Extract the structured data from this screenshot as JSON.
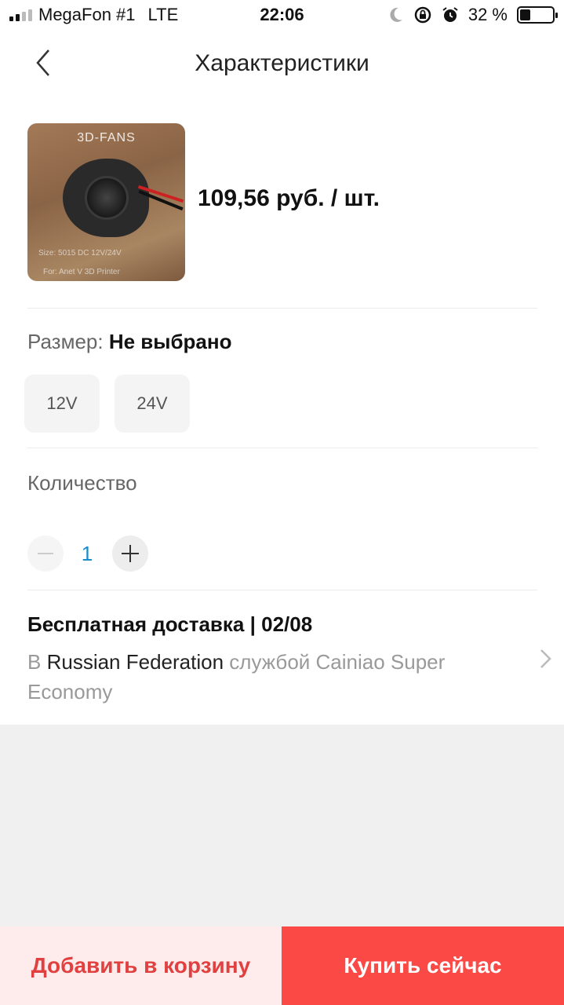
{
  "status_bar": {
    "carrier": "MegaFon #1",
    "network": "LTE",
    "time": "22:06",
    "battery_text": "32 %",
    "battery_level": 0.32,
    "icons": [
      "signal-icon",
      "moon-icon",
      "rotation-lock-icon",
      "alarm-icon",
      "battery-icon"
    ]
  },
  "nav": {
    "title": "Характеристики",
    "back_icon": "chevron-left-icon"
  },
  "product": {
    "image_text": {
      "brand": "3D-FANS",
      "spec": "Size: 5015 DC 12V/24V",
      "usage": "For: Anet V 3D Printer"
    },
    "price": "109,56 руб. / шт."
  },
  "size": {
    "label": "Размер:",
    "selected": "Не выбрано",
    "options": [
      "12V",
      "24V"
    ]
  },
  "quantity": {
    "label": "Количество",
    "value": "1"
  },
  "shipping": {
    "title": "Бесплатная доставка | 02/08",
    "prefix": "В",
    "destination": "Russian Federation",
    "service_text": "службой Cainiao Super Economy"
  },
  "actions": {
    "add_to_cart": "Добавить в корзину",
    "buy_now": "Купить сейчас"
  },
  "colors": {
    "accent_red": "#fb4946",
    "cart_text": "#e0403f",
    "cart_bg": "#fdeceb",
    "quantity_blue": "#1a8ccc"
  }
}
